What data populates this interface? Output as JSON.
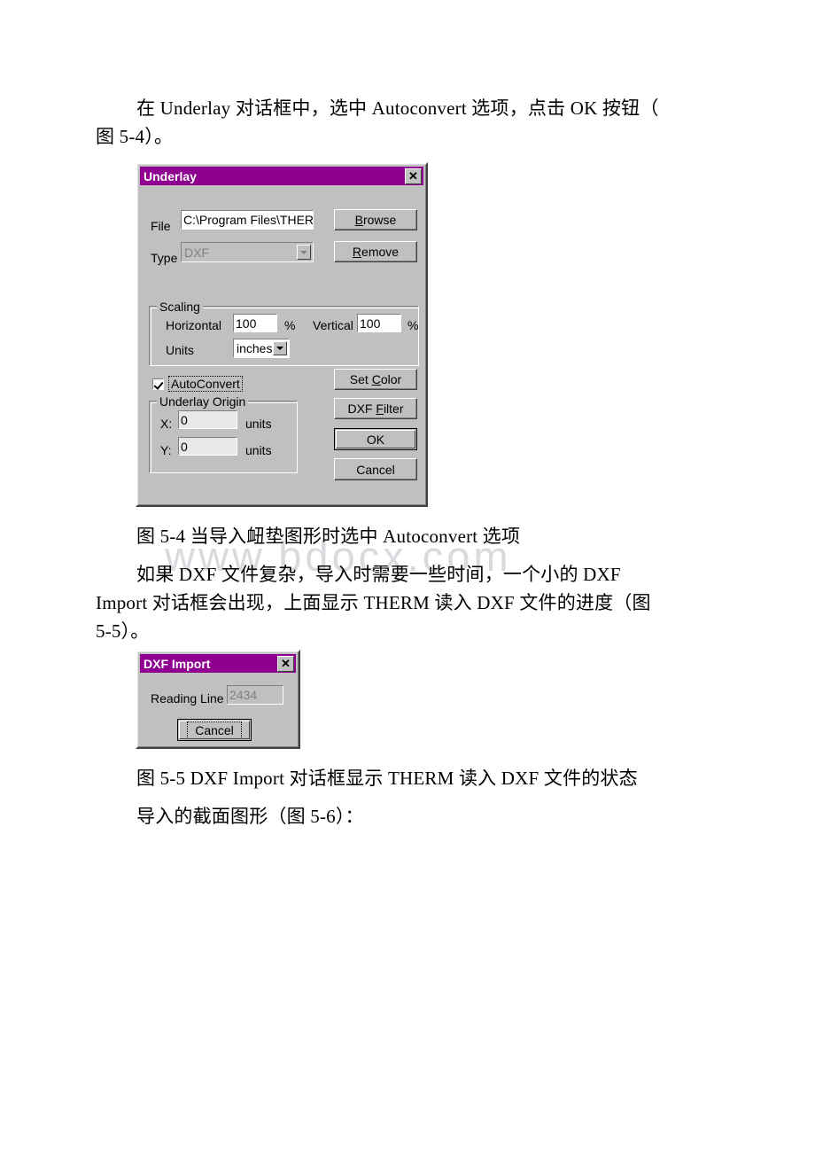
{
  "document": {
    "paragraphs": [
      {
        "id": "p1",
        "lines": [
          "在 Underlay 对话框中，选中 Autoconvert 选项，点击 OK 按钮（",
          "图 5-4）。"
        ]
      },
      {
        "id": "caption54",
        "lines": [
          "图 5-4 当导入衄垫图形时选中 Autoconvert 选项"
        ]
      },
      {
        "id": "p2",
        "lines": [
          "如果 DXF 文件复杂，导入时需要一些时间，一个小的 DXF",
          "Import 对话框会出现，上面显示 THERM 读入 DXF 文件的进度（图",
          "5-5）。"
        ]
      },
      {
        "id": "caption55",
        "lines": [
          "图 5-5 DXF Import 对话框显示 THERM 读入 DXF 文件的状态"
        ]
      },
      {
        "id": "p3",
        "lines": [
          "导入的截面图形（图 5-6）："
        ]
      }
    ],
    "watermark": "www.bdocx.com"
  },
  "underlay_dialog": {
    "title": "Underlay",
    "close_label": "✕",
    "file_label": "File",
    "file_value": "C:\\Program Files\\THER",
    "type_label": "Type",
    "type_value": "DXF",
    "browse_button": "Browse",
    "browse_mnemonic": "B",
    "remove_button": "Remove",
    "remove_mnemonic": "R",
    "scaling_group": "Scaling",
    "horizontal_label": "Horizontal",
    "horizontal_value": "100",
    "horizontal_unit": "%",
    "vertical_label": "Vertical",
    "vertical_value": "100",
    "vertical_unit": "%",
    "units_label": "Units",
    "units_value": "inches",
    "autoconvert_label": "AutoConvert",
    "autoconvert_checked": true,
    "origin_group": "Underlay Origin",
    "origin_x_label": "X:",
    "origin_x_value": "0",
    "origin_x_unit": "units",
    "origin_y_label": "Y:",
    "origin_y_value": "0",
    "origin_y_unit": "units",
    "set_color_button": "Set Color",
    "set_color_mnemonic": "C",
    "dxf_filter_button": "DXF Filter",
    "dxf_filter_mnemonic": "F",
    "ok_button": "OK",
    "cancel_button": "Cancel",
    "titlebar_color": "#900090",
    "face_color": "#c0c0c0"
  },
  "dxf_import_dialog": {
    "title": "DXF Import",
    "close_label": "✕",
    "reading_line_label": "Reading Line",
    "reading_line_value": "2434",
    "cancel_button": "Cancel",
    "titlebar_color": "#900090",
    "face_color": "#c0c0c0"
  }
}
